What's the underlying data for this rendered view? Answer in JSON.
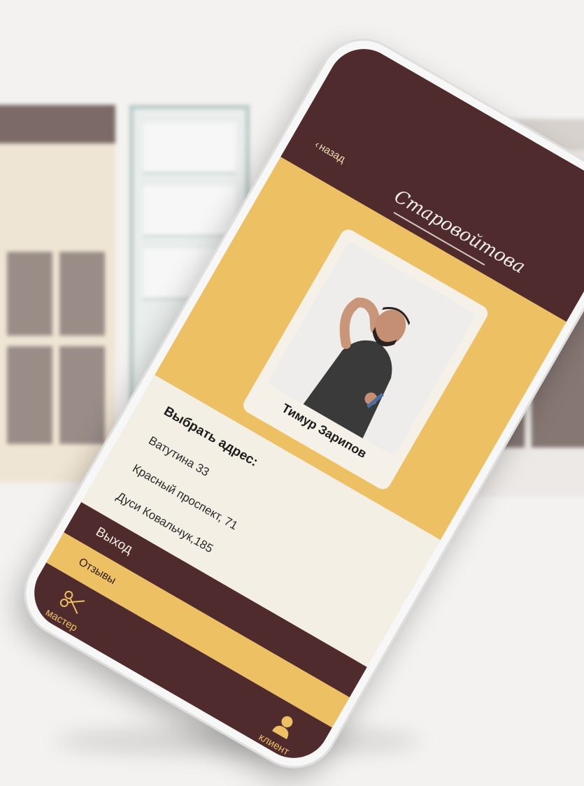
{
  "header": {
    "back_label": "назад",
    "logo_text": "Старовойтова"
  },
  "profile": {
    "name": "Тимур Зарипов"
  },
  "address": {
    "title": "Выбрать адрес:",
    "items": [
      "Ватутина 33",
      "Красный проспект, 71",
      "Дуси Ковальчук,185"
    ]
  },
  "menu": {
    "exit_label": "Выход",
    "reviews_label": "Отзывы"
  },
  "tabbar": {
    "master_label": "мастер",
    "master_icon": "scissors-icon",
    "client_label": "клиент",
    "client_icon": "person-icon"
  },
  "colors": {
    "brown": "#4f2b2d",
    "gold": "#edc064",
    "cream": "#f4efe4"
  }
}
